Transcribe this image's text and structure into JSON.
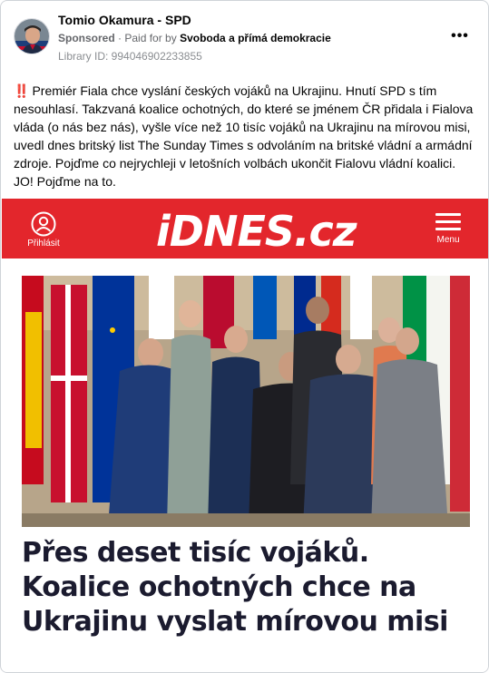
{
  "post": {
    "page_name": "Tomio Okamura - SPD",
    "sponsored": "Sponsored",
    "paid_prefix": "· Paid for by",
    "payer": "Svoboda a přímá demokracie",
    "library_id": "Library ID: 994046902233855",
    "more_icon": "more-dots-icon",
    "text": "Premiér Fiala chce vyslání českých vojáků na Ukrajinu. Hnutí SPD s tím nesouhlasí. Takzvaná koalice ochotných, do které se jménem ČR přidala i Fialova vláda (o nás bez nás), vyšle více než 10 tisíc vojáků na Ukrajinu na mírovou misi, uvedl dnes britský list The Sunday Times s odvoláním na britské vládní a armádní zdroje. Pojďme co nejrychleji v letošních volbách ukončit Fialovu vládní koalici. JO! Pojďme na to.",
    "text_emoji": "‼️"
  },
  "image": {
    "login_label": "Přihlásit",
    "logo": "iDNES.cz",
    "menu_label": "Menu",
    "headline": "Přes deset tisíc vojáků. Koalice ochotných chce na Ukrajinu vyslat mírovou misi"
  },
  "colors": {
    "idnes_red": "#e3262c",
    "headline": "#1b1b2f",
    "meta_gray": "#65676b"
  }
}
